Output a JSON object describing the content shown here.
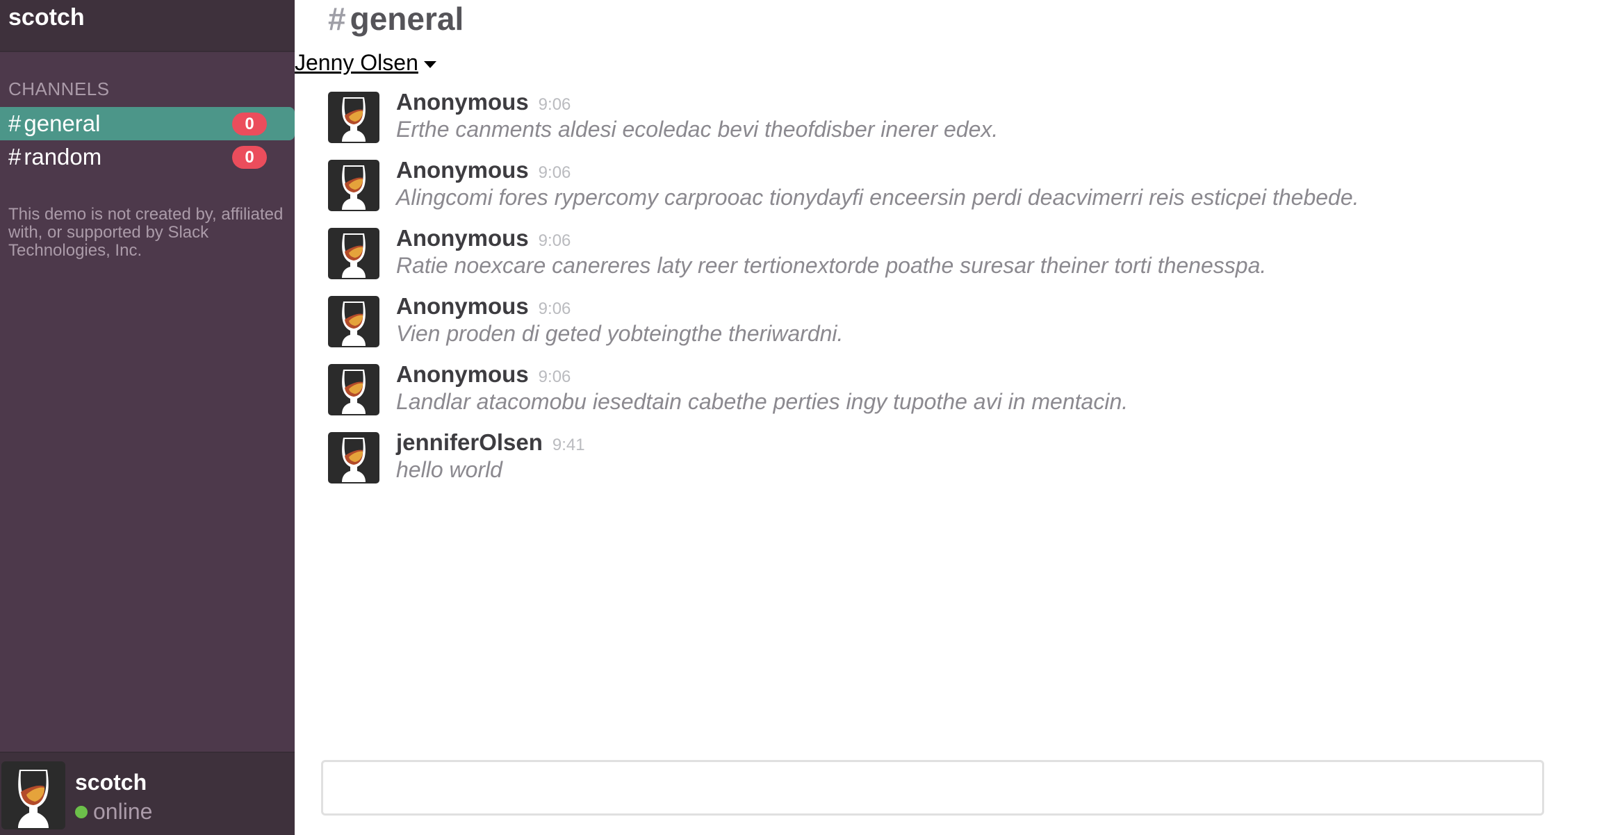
{
  "sidebar": {
    "team_name": "scotch",
    "channels_heading": "CHANNELS",
    "channels": [
      {
        "name": "general",
        "hash": "#",
        "unread": "0",
        "active": true
      },
      {
        "name": "random",
        "hash": "#",
        "unread": "0",
        "active": false
      }
    ],
    "disclaimer": "This demo is not created by, affiliated with, or supported by Slack Technologies, Inc.",
    "user": {
      "name": "scotch",
      "status": "online",
      "avatar_icon": "whisky-glass-icon"
    }
  },
  "header": {
    "hash": "#",
    "channel": "general",
    "user_menu": "Jenny Olsen"
  },
  "messages": [
    {
      "user": "Anonymous",
      "time": "9:06",
      "text": "Erthe canments aldesi ecoledac bevi theofdisber inerer edex.",
      "avatar_icon": "whisky-glass-icon"
    },
    {
      "user": "Anonymous",
      "time": "9:06",
      "text": "Alingcomi fores rypercomy carprooac tionydayfi enceersin perdi deacvimerri reis esticpei thebede.",
      "avatar_icon": "whisky-glass-icon"
    },
    {
      "user": "Anonymous",
      "time": "9:06",
      "text": "Ratie noexcare canereres laty reer tertionextorde poathe suresar theiner torti thenesspa.",
      "avatar_icon": "whisky-glass-icon"
    },
    {
      "user": "Anonymous",
      "time": "9:06",
      "text": "Vien proden di geted yobteingthe theriwardni.",
      "avatar_icon": "whisky-glass-icon"
    },
    {
      "user": "Anonymous",
      "time": "9:06",
      "text": "Landlar atacomobu iesedtain cabethe perties ingy tupothe avi in mentacin.",
      "avatar_icon": "whisky-glass-icon"
    },
    {
      "user": "jenniferOlsen",
      "time": "9:41",
      "text": "hello world",
      "avatar_icon": "whisky-glass-icon"
    }
  ],
  "composer": {
    "value": "",
    "placeholder": ""
  },
  "colors": {
    "sidebar_bg": "#4d394b",
    "sidebar_header_bg": "#3e313c",
    "active_channel": "#4c9689",
    "badge": "#eb4d5c",
    "online": "#6cc04a"
  }
}
